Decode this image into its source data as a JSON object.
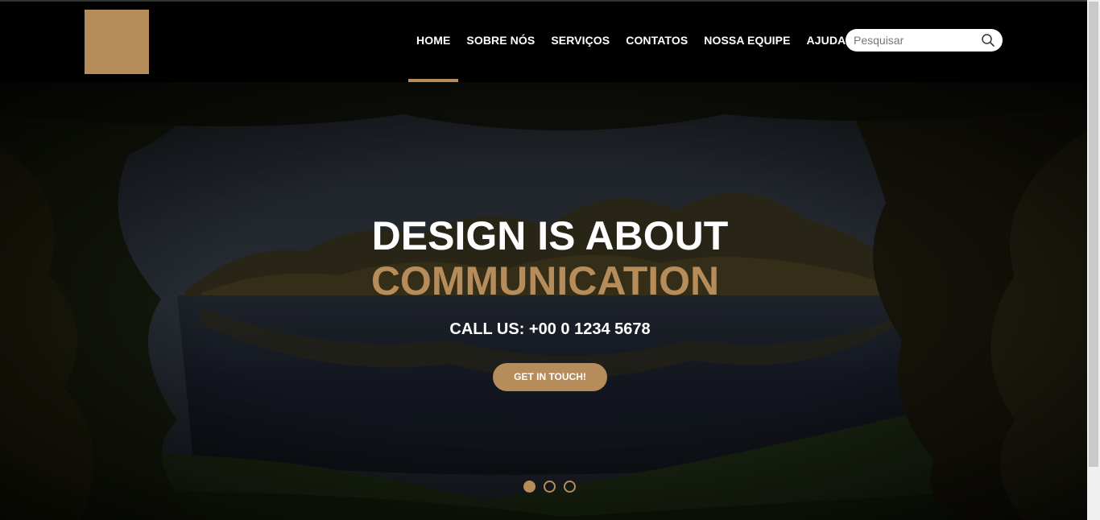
{
  "header": {
    "nav": [
      {
        "label": "HOME",
        "active": true
      },
      {
        "label": "SOBRE NÓS",
        "active": false
      },
      {
        "label": "SERVIÇOS",
        "active": false
      },
      {
        "label": "CONTATOS",
        "active": false
      },
      {
        "label": "NOSSA EQUIPE",
        "active": false
      },
      {
        "label": "AJUDA",
        "active": false
      }
    ],
    "search": {
      "placeholder": "Pesquisar",
      "icon": "search-icon"
    }
  },
  "hero": {
    "headline": "DESIGN IS ABOUT",
    "headline_accent": "COMMUNICATION",
    "callus": "CALL US: +00 0 1234 5678",
    "cta_label": "GET IN TOUCH!",
    "slide_count": 3,
    "active_slide": 1
  },
  "colors": {
    "accent": "#b68c5a",
    "background": "#000000",
    "text": "#ffffff"
  }
}
